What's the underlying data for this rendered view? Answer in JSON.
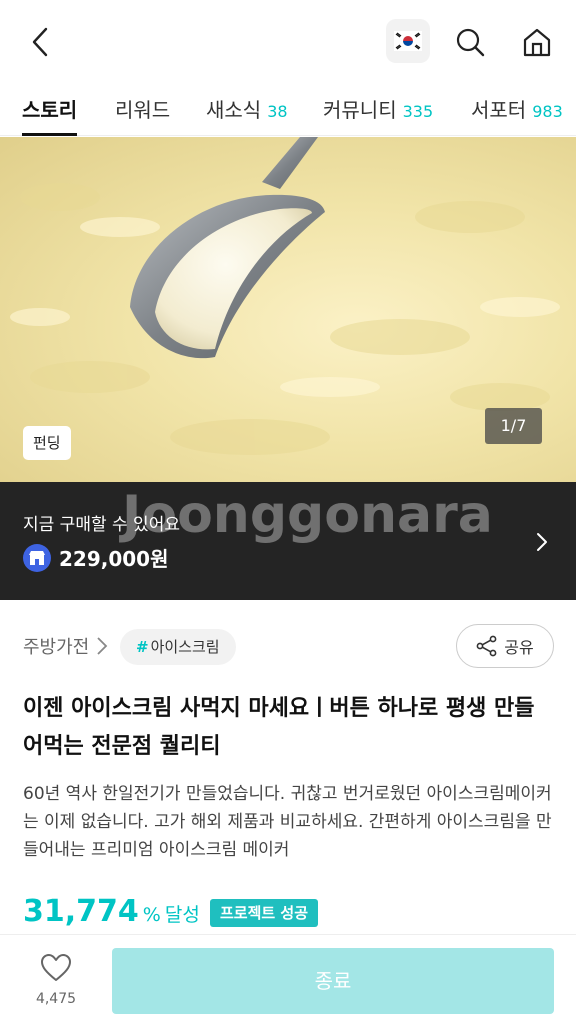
{
  "header": {
    "back_icon": "chevron-left-icon",
    "flag_icon": "korea-flag-icon",
    "search_icon": "search-icon",
    "home_icon": "home-icon"
  },
  "tabs": [
    {
      "label": "스토리",
      "count": ""
    },
    {
      "label": "리워드",
      "count": ""
    },
    {
      "label": "새소식",
      "count": "38"
    },
    {
      "label": "커뮤니티",
      "count": "335"
    },
    {
      "label": "서포터",
      "count": "983"
    }
  ],
  "hero": {
    "badge": "펀딩",
    "page_indicator": "1/7"
  },
  "purchase": {
    "label": "지금 구매할 수 있어요",
    "price": "229,000원",
    "watermark": "Joonggonara"
  },
  "category": {
    "name": "주방가전",
    "tag_hash": "#",
    "tag": "아이스크림",
    "share_label": "공유"
  },
  "project": {
    "title": "이젠 아이스크림 사먹지 마세요ㅣ버튼 하나로 평생 만들어먹는 전문점 퀄리티",
    "description": "60년 역사 한일전기가 만들었습니다. 귀찮고 번거로웠던 아이스크림메이커는 이제 없습니다. 고가 해외 제품과 비교하세요. 간편하게 아이스크림을 만들어내는 프리미엄 아이스크림 메이커",
    "achieve_value": "31,774",
    "achieve_unit": "%",
    "achieve_label": "달성",
    "status_badge": "프로젝트 성공"
  },
  "bottom": {
    "like_count": "4,475",
    "action_label": "종료"
  },
  "colors": {
    "accent": "#00c4c4",
    "banner_bg": "#242424",
    "disabled_button": "#a3e6e6",
    "store_icon": "#3e63e2"
  }
}
